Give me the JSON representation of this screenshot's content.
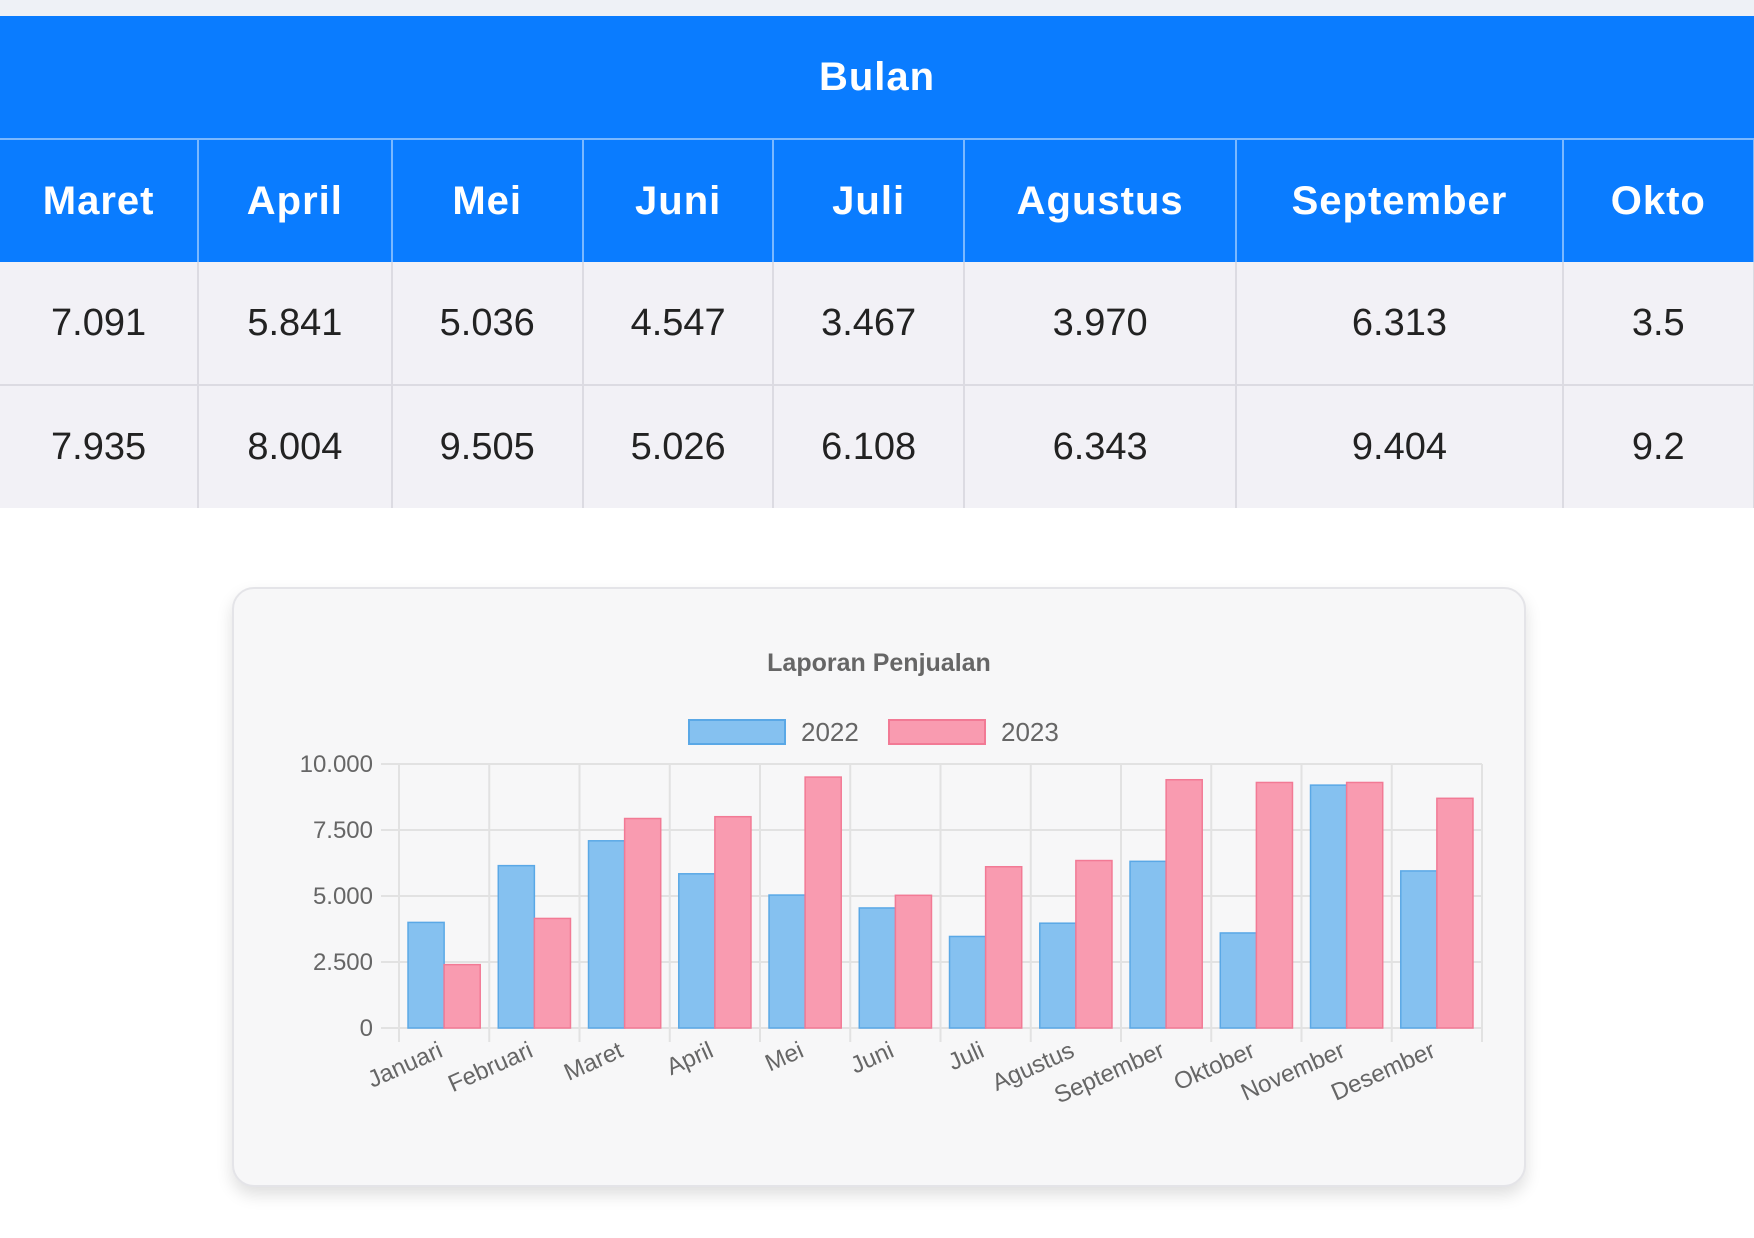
{
  "table": {
    "group_header": "Bulan",
    "months": [
      "Maret",
      "April",
      "Mei",
      "Juni",
      "Juli",
      "Agustus",
      "September",
      "Okto"
    ],
    "rows": [
      [
        "7.091",
        "5.841",
        "5.036",
        "4.547",
        "3.467",
        "3.970",
        "6.313",
        "3.5"
      ],
      [
        "7.935",
        "8.004",
        "9.505",
        "5.026",
        "6.108",
        "6.343",
        "9.404",
        "9.2"
      ]
    ]
  },
  "chart_data": {
    "type": "bar",
    "title": "Laporan Penjualan",
    "categories": [
      "Januari",
      "Februari",
      "Maret",
      "April",
      "Mei",
      "Juni",
      "Juli",
      "Agustus",
      "September",
      "Oktober",
      "November",
      "Desember"
    ],
    "series": [
      {
        "name": "2022",
        "values": [
          4000,
          6150,
          7091,
          5841,
          5036,
          4547,
          3467,
          3970,
          6313,
          3600,
          9200,
          5950
        ],
        "color": "#85c1f0",
        "border": "#5aa8e6"
      },
      {
        "name": "2023",
        "values": [
          2400,
          4150,
          7935,
          8004,
          9505,
          5026,
          6108,
          6343,
          9404,
          9300,
          9300,
          8700
        ],
        "color": "#f99bb0",
        "border": "#f27a95"
      }
    ],
    "yticks": [
      "0",
      "2.500",
      "5.000",
      "7.500",
      "10.000"
    ],
    "ylim": [
      0,
      10000
    ],
    "legend_position": "top",
    "grid": true
  }
}
